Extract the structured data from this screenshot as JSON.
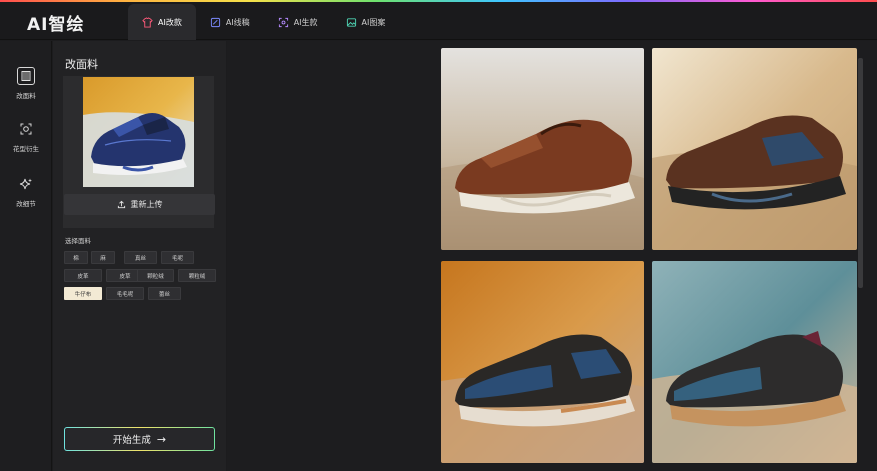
{
  "app": {
    "logo": "AI智绘"
  },
  "tabs": [
    {
      "label": "AI改款",
      "icon": "shirt-icon",
      "active": true
    },
    {
      "label": "AI线稿",
      "icon": "sketch-icon",
      "active": false
    },
    {
      "label": "AI生款",
      "icon": "generate-icon",
      "active": false
    },
    {
      "label": "AI图案",
      "icon": "pattern-icon",
      "active": false
    }
  ],
  "sidebar": {
    "items": [
      {
        "label": "改面料",
        "icon": "fabric-icon",
        "active": true
      },
      {
        "label": "花型衍生",
        "icon": "flower-icon",
        "active": false
      },
      {
        "label": "改细节",
        "icon": "sparkle-icon",
        "active": false
      }
    ]
  },
  "panel": {
    "title": "改面料",
    "reupload_label": "重新上传",
    "materials_label": "选择面料",
    "materials": [
      "棉",
      "麻",
      "真丝",
      "毛呢",
      "皮革",
      "皮草",
      "颗粒绒",
      "颗粒绒",
      "牛仔布",
      "毛毛呢",
      "蕾丝"
    ],
    "selected_material": "牛仔布",
    "start_label": "开始生成"
  },
  "colors": {
    "accent_start": "#6fe3e0",
    "accent_mid": "#f0e36a",
    "selected_chip": "#f3ead4"
  }
}
